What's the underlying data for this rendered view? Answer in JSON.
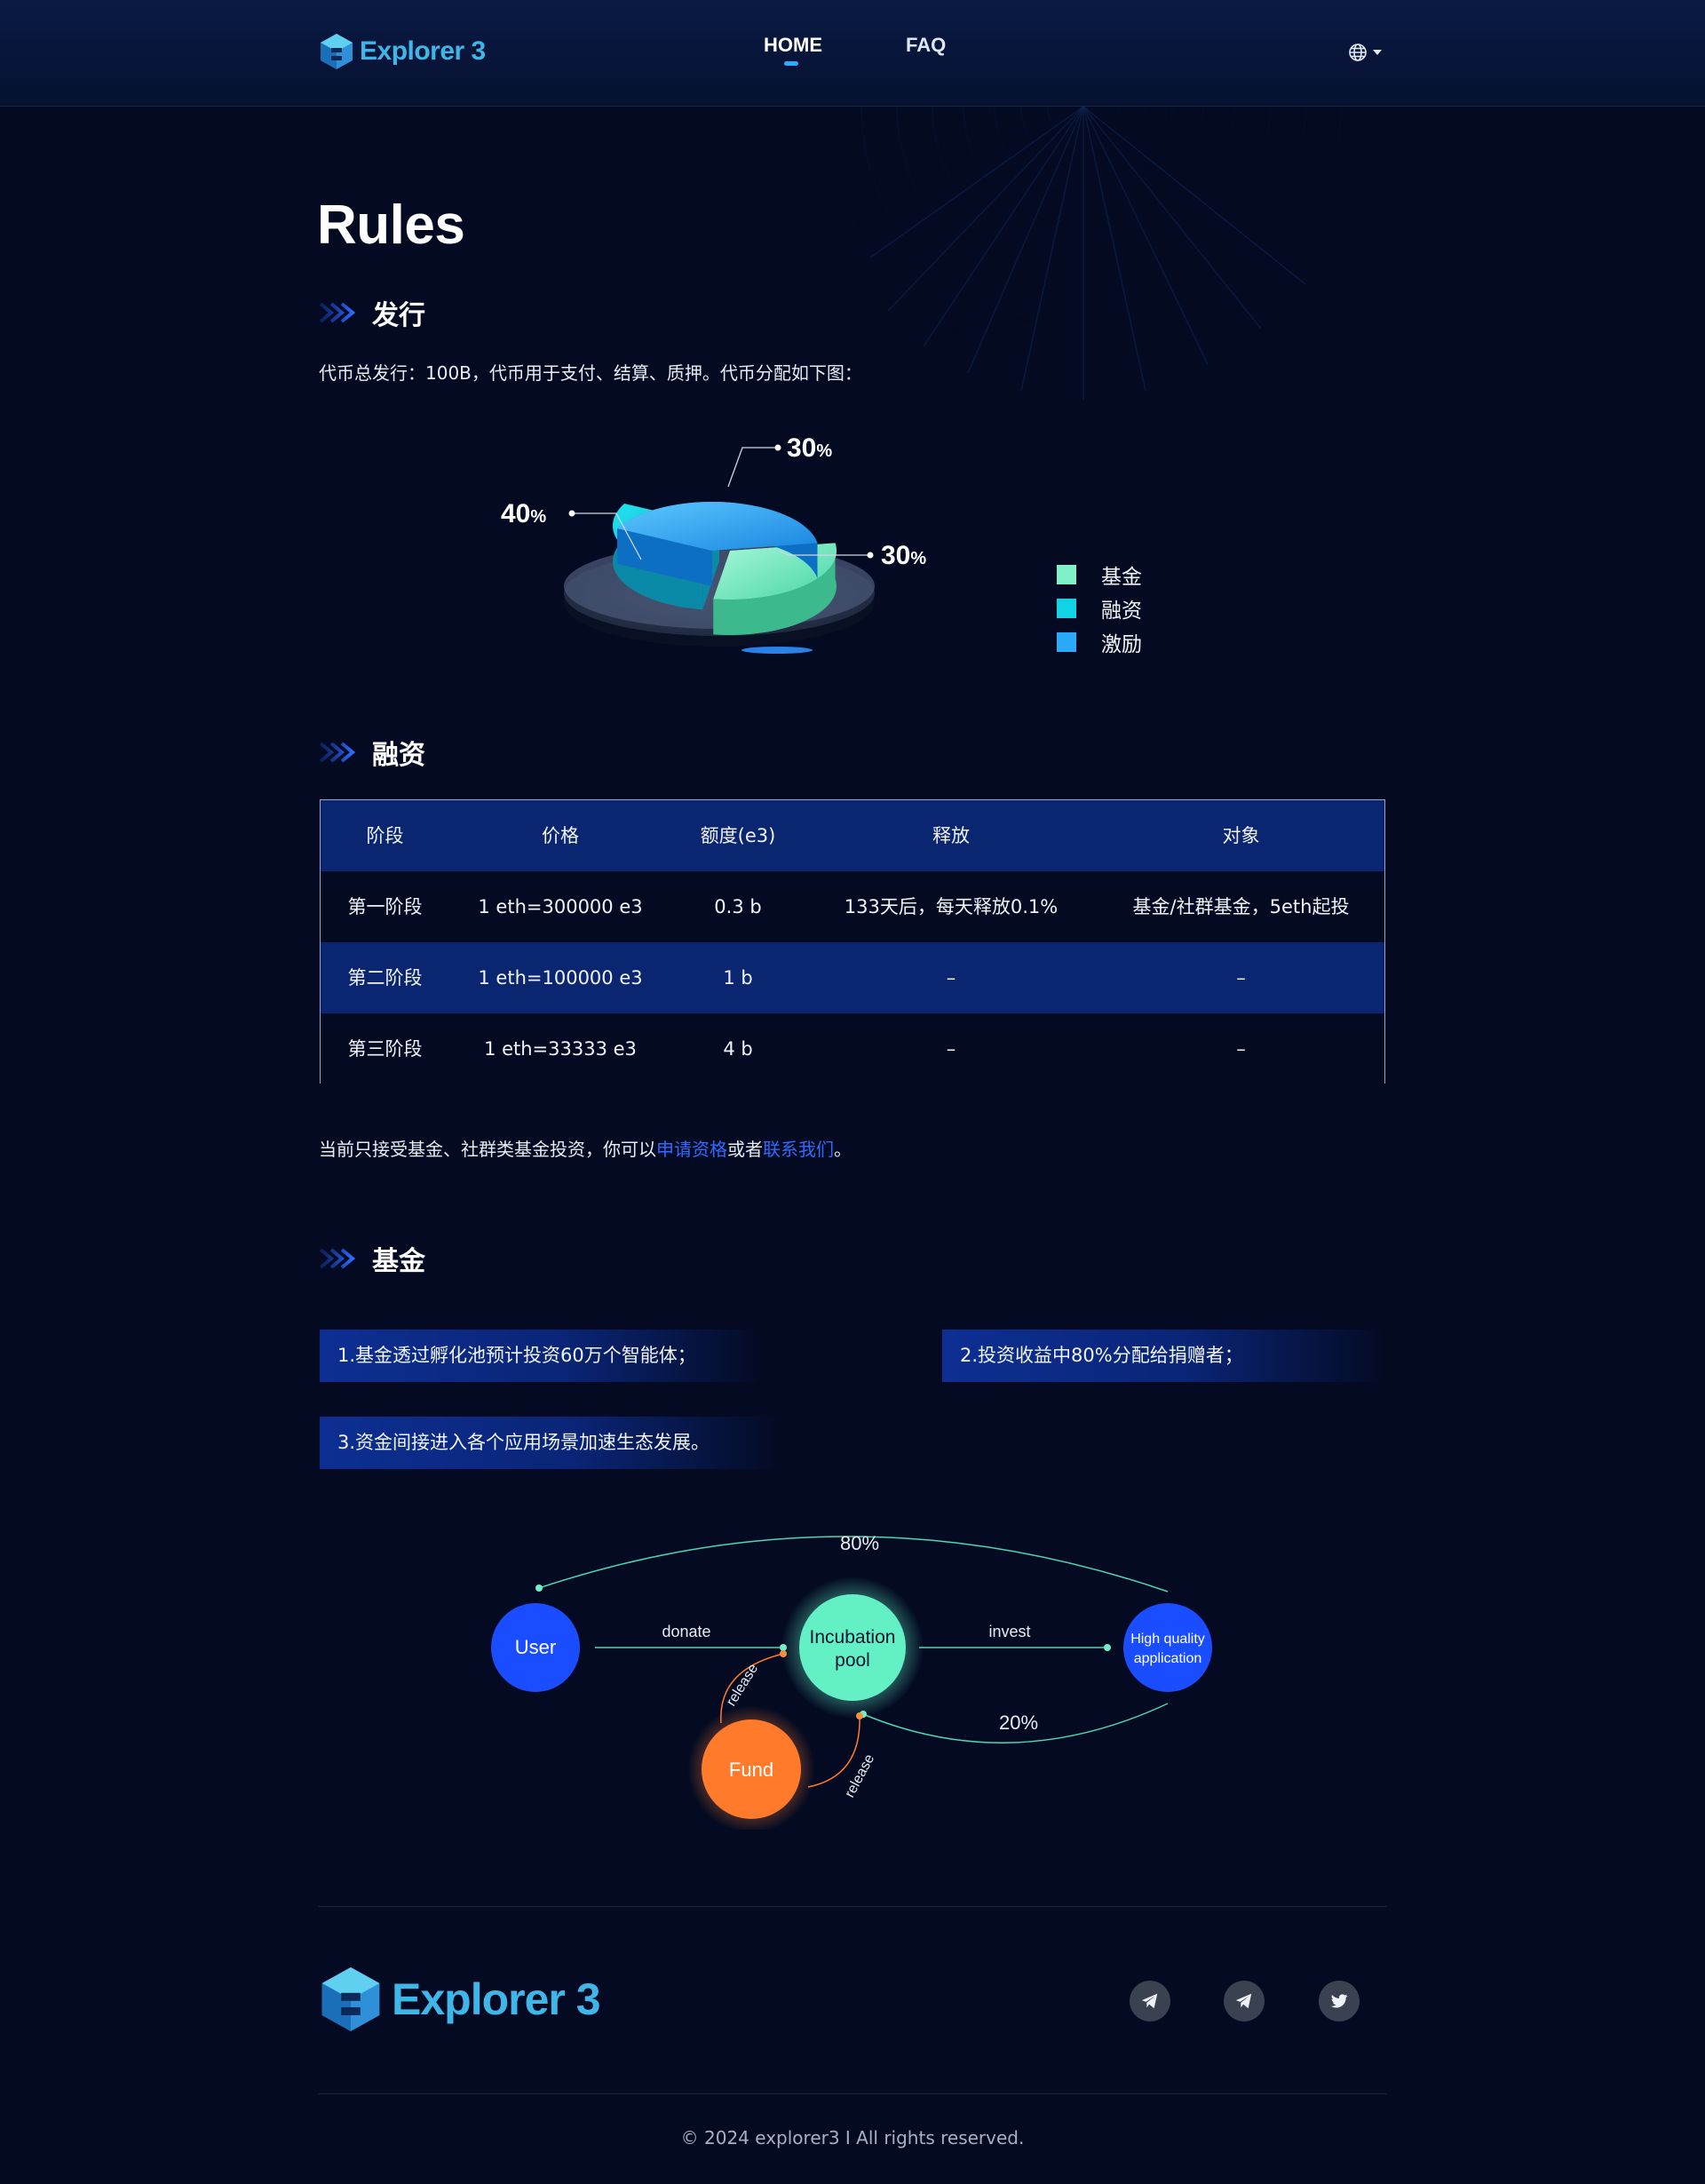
{
  "header": {
    "logo_text": "Explorer 3",
    "nav": [
      {
        "label": "HOME",
        "active": true
      },
      {
        "label": "FAQ",
        "active": false
      }
    ],
    "language_icon": "globe-icon"
  },
  "page": {
    "title": "Rules"
  },
  "issuance": {
    "heading": "发行",
    "description": "代币总发行：100B，代币用于支付、结算、质押。代币分配如下图："
  },
  "chart_data": {
    "type": "pie",
    "categories": [
      "基金",
      "融资",
      "激励"
    ],
    "values": [
      30,
      30,
      40
    ],
    "value_labels": [
      {
        "num": "30",
        "unit": "%"
      },
      {
        "num": "30",
        "unit": "%"
      },
      {
        "num": "40",
        "unit": "%"
      }
    ],
    "colors": [
      "#7ff0c8",
      "#10d4e4",
      "#2aaaf8"
    ],
    "legend_position": "right"
  },
  "financing": {
    "heading": "融资",
    "table": {
      "headers": [
        "阶段",
        "价格",
        "额度(e3)",
        "释放",
        "对象"
      ],
      "rows": [
        [
          "第一阶段",
          "1 eth=300000 e3",
          "0.3 b",
          "133天后，每天释放0.1%",
          "基金/社群基金，5eth起投"
        ],
        [
          "第二阶段",
          "1 eth=100000 e3",
          "1 b",
          "–",
          "–"
        ],
        [
          "第三阶段",
          "1 eth=33333 e3",
          "4 b",
          "–",
          "–"
        ]
      ]
    },
    "note_before": "当前只接受基金、社群类基金投资，你可以",
    "apply_link": "申请资格",
    "note_mid": "或者",
    "contact_link": "联系我们",
    "note_end": "。"
  },
  "fund": {
    "heading": "基金",
    "points": [
      "1.基金透过孵化池预计投资60万个智能体；",
      "2.投资收益中80%分配给捐赠者；",
      "3.资金间接进入各个应用场景加速生态发展。"
    ],
    "flow": {
      "user": "User",
      "pool_line1": "Incubation",
      "pool_line2": "pool",
      "fund": "Fund",
      "app_line1": "High quality",
      "app_line2": "application",
      "donate": "donate",
      "invest": "invest",
      "release": "release",
      "pct_top": "80%",
      "pct_bottom": "20%"
    }
  },
  "footer": {
    "logo_text": "Explorer 3",
    "social_icons": [
      "telegram-icon",
      "telegram-icon",
      "twitter-icon"
    ],
    "copyright": "© 2024 explorer3 I All rights reserved."
  }
}
